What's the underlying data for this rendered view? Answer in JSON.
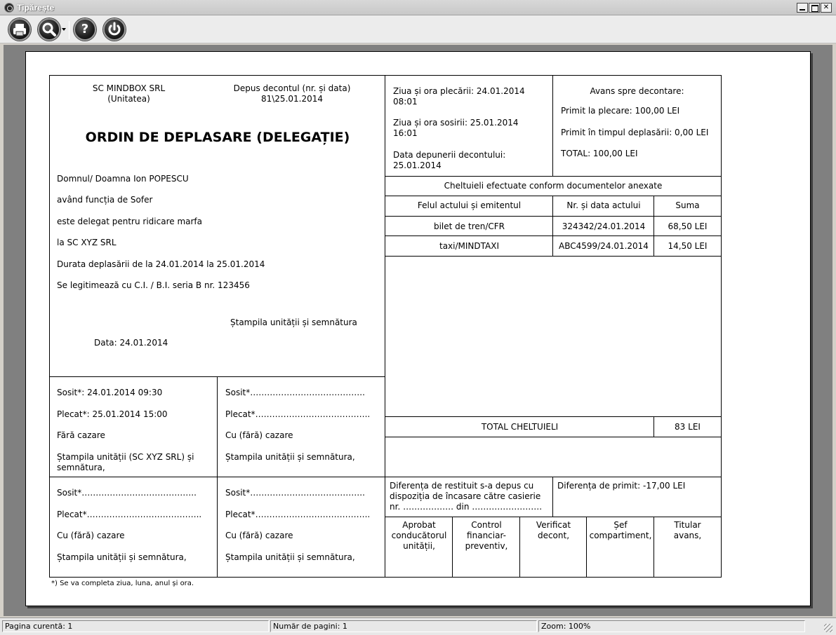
{
  "window": {
    "title": "Tipărește"
  },
  "toolbar": {
    "print_icon": "print-icon",
    "zoom_icon": "magnifier-icon",
    "help_glyph": "?",
    "exit_icon": "power-icon"
  },
  "form": {
    "company": "SC MINDBOX SRL",
    "company_label": "(Unitatea)",
    "deposit_label": "Depus decontul (nr. și data)",
    "deposit_value": "81\\25.01.2014",
    "title": "ORDIN DE DEPLASARE (DELEGAȚIE)",
    "person": "Domnul/ Doamna Ion POPESCU",
    "function": "având funcția de Sofer",
    "purpose": "este delegat pentru ridicare marfa",
    "destination": "la SC XYZ SRL",
    "duration": "Durata deplasării de la 24.01.2014 la 25.01.2014",
    "identity": "Se legitimează cu C.I. / B.I. seria B nr. 123456",
    "stamp_signature": "Ștampila unității și semnătura",
    "date": "Data: 24.01.2014",
    "departure_l1": "Ziua și ora plecării: 24.01.2014",
    "departure_l2": "08:01",
    "arrival_l1": "Ziua și ora sosirii: 25.01.2014",
    "arrival_l2": "16:01",
    "settlement_l1": "Data depunerii decontului:",
    "settlement_l2": "25.01.2014",
    "advance_title": "Avans spre decontare:",
    "advance_departure": "Primit la plecare: 100,00 LEI",
    "advance_during": "Primit în timpul deplasării: 0,00 LEI",
    "advance_total": "TOTAL: 100,00 LEI",
    "expenses_title": "Cheltuieli efectuate conform documentelor anexate",
    "expenses_headers": [
      "Felul actului și emitentul",
      "Nr. și data actului",
      "Suma"
    ],
    "expenses_rows": [
      [
        "bilet de tren/CFR",
        "324342/24.01.2014",
        "68,50 LEI"
      ],
      [
        "taxi/MINDTAXI",
        "ABC4599/24.01.2014",
        "14,50 LEI"
      ]
    ],
    "total_label": "TOTAL CHELTUIELI",
    "total_value": "83 LEI",
    "stop1_arrival": "Sosit*: 24.01.2014 09:30",
    "stop1_departure": "Plecat*: 25.01.2014 15:00",
    "stop1_lodging": "Fără cazare",
    "stop1_stamp_l1": "Ștampila unității (SC XYZ SRL) și",
    "stop1_stamp_l2": "semnătura,",
    "blank_arrival": "Sosit*…………………………………..",
    "blank_departure": "Plecat*…………………………………..",
    "blank_lodging": "Cu (fără) cazare",
    "blank_stamp": "Ștampila unității și semnătura,",
    "refund_l1": "Diferența de restituit s-a depus cu",
    "refund_l2": "dispoziția de încasare către casierie",
    "refund_l3": "nr. ……………… din …………………….",
    "receive_diff": "Diferența de primit: -17,00 LEI",
    "approvals": [
      [
        "Aprobat",
        "conducătorul",
        "unității,"
      ],
      [
        "Control",
        "financiar-",
        "preventiv,"
      ],
      [
        "Verificat",
        "decont,"
      ],
      [
        "Șef",
        "compartiment,"
      ],
      [
        "Titular",
        "avans,"
      ]
    ],
    "footnote": "*) Se va completa ziua, luna, anul și ora."
  },
  "status": {
    "current_page": "Pagina curentă: 1",
    "page_count": "Număr de pagini: 1",
    "zoom": "Zoom: 100%"
  }
}
